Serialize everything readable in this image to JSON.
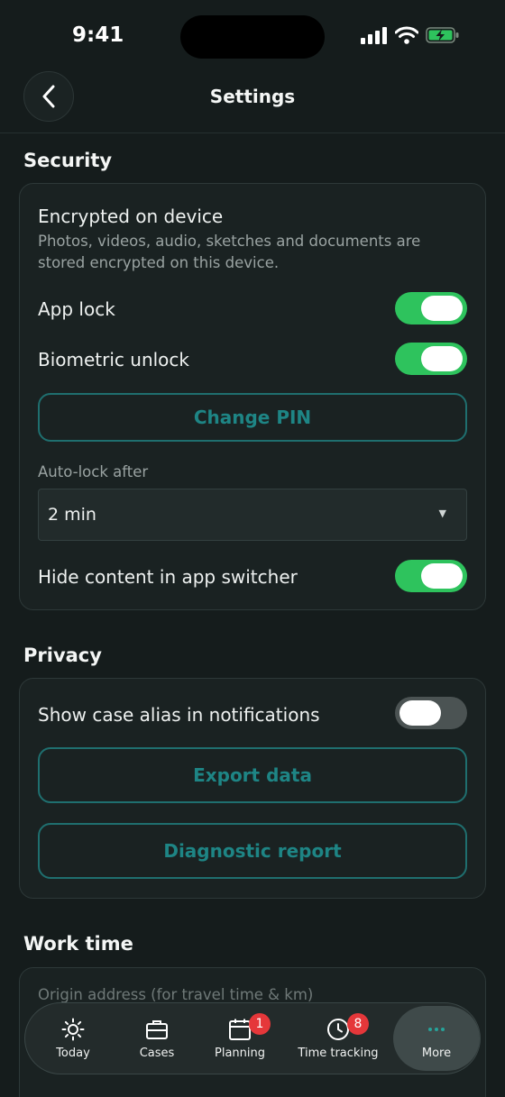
{
  "status_bar": {
    "time": "9:41",
    "icons": [
      "signal-icon",
      "wifi-icon",
      "battery-charging-icon"
    ]
  },
  "header": {
    "title": "Settings",
    "back_icon": "chevron-left-icon"
  },
  "security": {
    "title": "Security",
    "encrypted_title": "Encrypted on device",
    "encrypted_desc": "Photos, videos, audio, sketches and documents are stored encrypted on this device.",
    "app_lock_label": "App lock",
    "app_lock_on": true,
    "biometric_label": "Biometric unlock",
    "biometric_on": true,
    "change_pin_label": "Change PIN",
    "auto_lock_label": "Auto-lock after",
    "auto_lock_value": "2 min",
    "hide_content_label": "Hide content in app switcher",
    "hide_content_on": true
  },
  "privacy": {
    "title": "Privacy",
    "alias_label": "Show case alias in notifications",
    "alias_on": false,
    "export_label": "Export data",
    "diagnostic_label": "Diagnostic report"
  },
  "work_time": {
    "title": "Work time",
    "origin_label": "Origin address (for travel time & km)"
  },
  "tabs": [
    {
      "label": "Today",
      "icon": "sun-icon"
    },
    {
      "label": "Cases",
      "icon": "briefcase-icon"
    },
    {
      "label": "Planning",
      "icon": "calendar-icon",
      "badge": "1"
    },
    {
      "label": "Time tracking",
      "icon": "clock-icon",
      "badge": "8"
    },
    {
      "label": "More",
      "icon": "more-dots-icon",
      "active": true
    }
  ],
  "colors": {
    "background": "#151c1c",
    "card": "#1a2222",
    "accent_teal": "#1e8585",
    "toggle_on": "#2ec35d",
    "badge_red": "#e5373a"
  }
}
